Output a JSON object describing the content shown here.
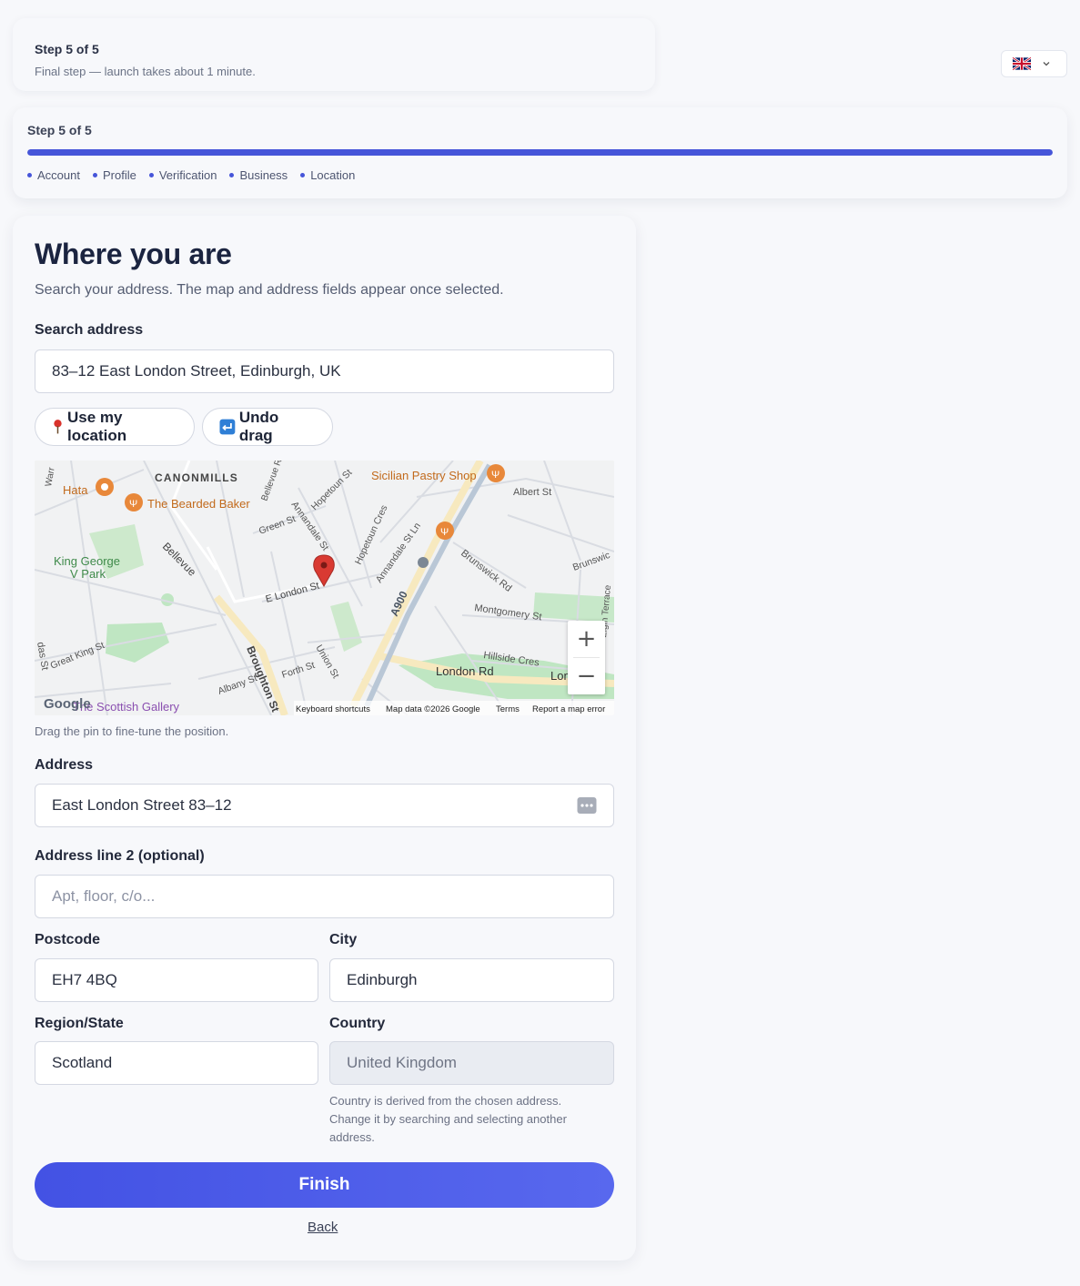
{
  "header": {
    "step_title": "Step 5 of 5",
    "step_sub": "Final step — launch takes about 1 minute.",
    "language_flag": "uk-flag-icon"
  },
  "progress": {
    "label": "Step 5 of 5",
    "fraction": 1.0,
    "steps": [
      "Account",
      "Profile",
      "Verification",
      "Business",
      "Location"
    ],
    "accent": "#4655d9"
  },
  "form": {
    "title": "Where you are",
    "subtitle": "Search your address. The map and address fields appear once selected.",
    "search_label": "Search address",
    "search_value": "83–12 East London Street, Edinburgh, UK",
    "use_location_label": "Use my location",
    "undo_drag_label": "Undo drag",
    "map_hint": "Drag the pin to fine-tune the position.",
    "address_label": "Address",
    "address_value": "East London Street 83–12",
    "address2_label": "Address line 2 (optional)",
    "address2_placeholder": "Apt, floor, c/o...",
    "postcode_label": "Postcode",
    "postcode_value": "EH7 4BQ",
    "city_label": "City",
    "city_value": "Edinburgh",
    "region_label": "Region/State",
    "region_value": "Scotland",
    "country_label": "Country",
    "country_value": "United Kingdom",
    "country_note": "Country is derived from the chosen address. Change it by searching and selecting another address.",
    "finish_label": "Finish",
    "back_label": "Back"
  },
  "map": {
    "labels": {
      "canonmills": "CANONMILLS",
      "hata": "Hata",
      "bearded_baker": "The Bearded Baker",
      "sicilian": "Sicilian Pastry Shop",
      "albert": "Albert St",
      "king_george": "King George",
      "v_park": "V Park",
      "bellevue": "Bellevue",
      "green_st": "Green St",
      "annandale": "Annandale St",
      "hopetoun": "Hopetoun St",
      "hopetoun_cres": "Hopetoun Cres",
      "annandale_ln": "Annandale St Ln",
      "brunswick_rd": "Brunswick Rd",
      "brunswick": "Brunswic",
      "e_london": "E London St",
      "a900": "A900",
      "montgomery": "Montgomery St",
      "hillside": "Hillside Cres",
      "london_rd": "London Rd",
      "lon": "Lon",
      "great_king": "Great King St",
      "broughton": "Broughton St",
      "albany": "Albany St",
      "forth": "Forth St",
      "union": "Union St",
      "scottish_gallery": "The Scottish Gallery",
      "elgin": "Elgin Terrace",
      "warr": "Warr",
      "das": "das St",
      "bellevue_r": "Bellevue R",
      "google": "Google",
      "attr_shortcuts": "Keyboard shortcuts",
      "attr_data": "Map data ©2026 Google",
      "attr_terms": "Terms",
      "attr_report": "Report a map error",
      "zoom_in": "+",
      "zoom_out": "−"
    },
    "pin_color": "#d93a32",
    "poi_color": "#e8883a"
  }
}
